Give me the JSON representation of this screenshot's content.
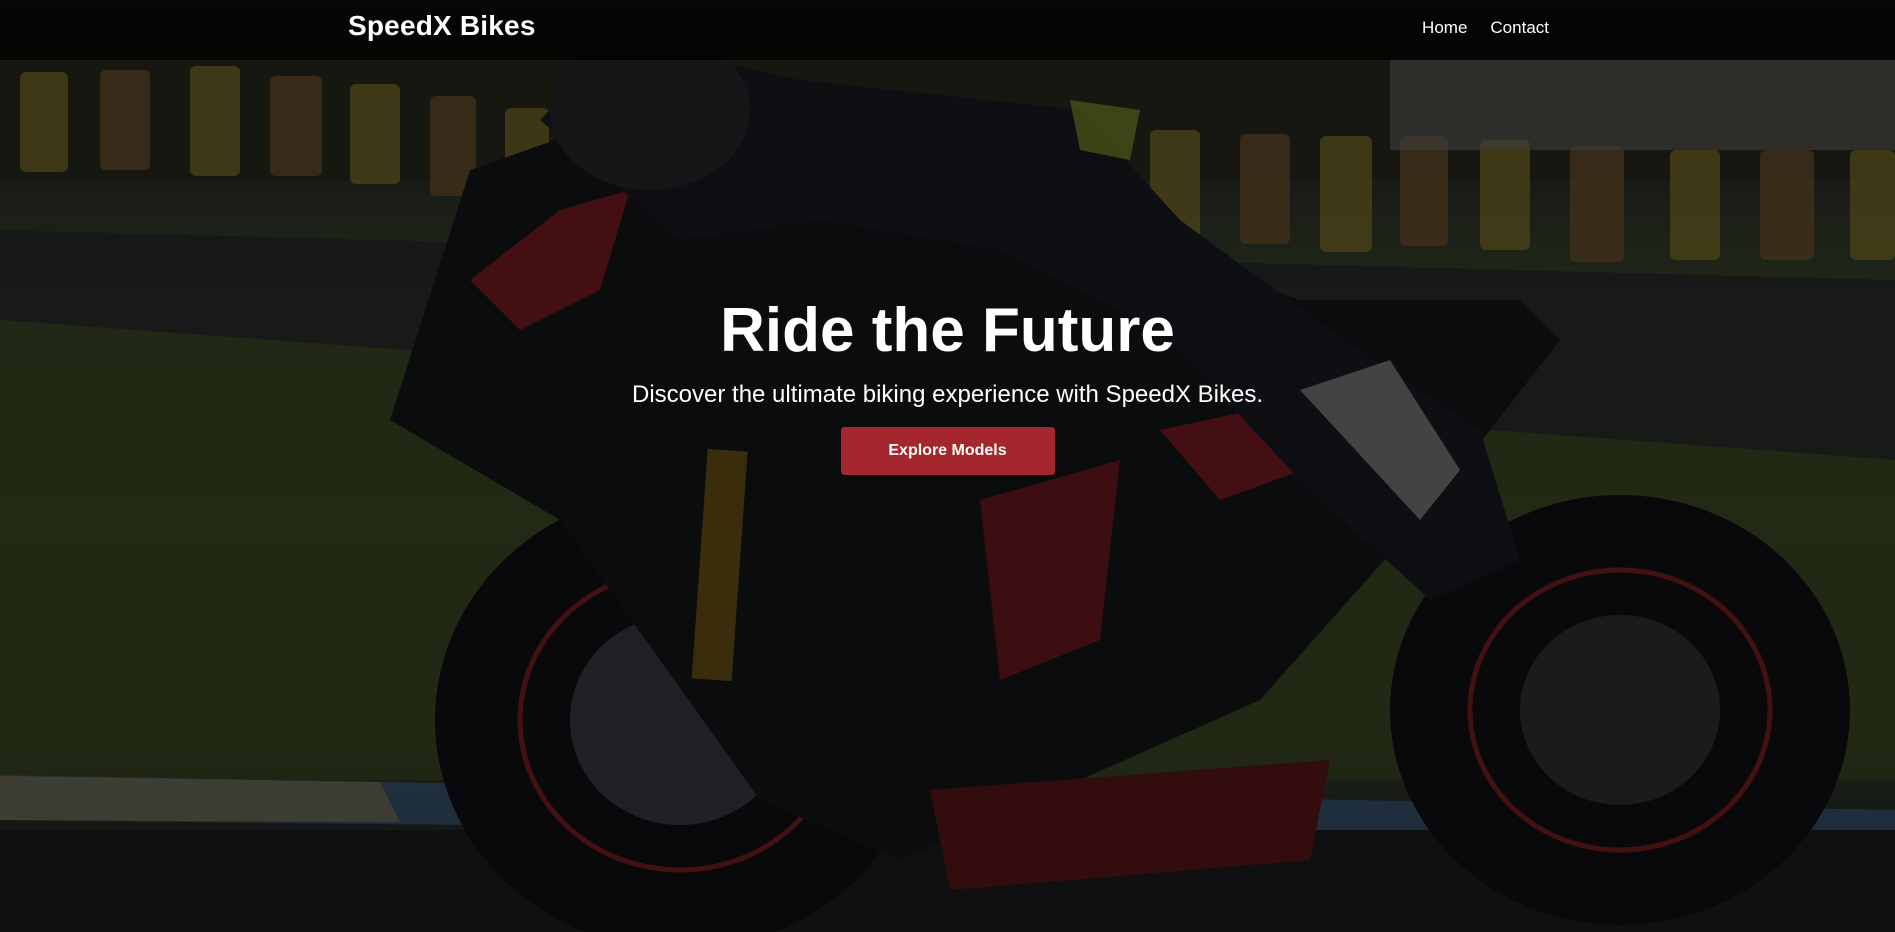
{
  "navbar": {
    "brand": "SpeedX Bikes",
    "links": [
      {
        "label": "Home"
      },
      {
        "label": "Contact"
      }
    ]
  },
  "hero": {
    "title": "Ride the Future",
    "subtitle": "Discover the ultimate biking experience with SpeedX Bikes.",
    "cta_label": "Explore Models",
    "background_image": "motorcycle-racing-photo"
  },
  "colors": {
    "navbar_bg": "#000000",
    "accent": "#a3272c",
    "text": "#ffffff"
  }
}
